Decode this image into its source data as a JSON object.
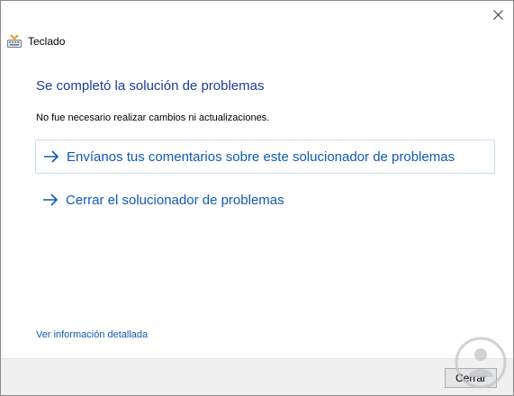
{
  "window": {
    "app_title": "Teclado",
    "close_glyph": "✕"
  },
  "content": {
    "heading": "Se completó la solución de problemas",
    "message": "No fue necesario realizar cambios ni actualizaciones.",
    "links": [
      {
        "label": "Envíanos tus comentarios sobre este solucionador de problemas",
        "icon": "arrow-right-icon"
      },
      {
        "label": "Cerrar el solucionador de problemas",
        "icon": "arrow-right-icon"
      }
    ],
    "details_link": "Ver información detallada"
  },
  "footer": {
    "close_button_label": "Cerrar"
  },
  "colors": {
    "heading": "#1a3e96",
    "link": "#0f5ab4",
    "footer_bg": "#f0f0f0",
    "desktop": "#2b6fb3"
  }
}
